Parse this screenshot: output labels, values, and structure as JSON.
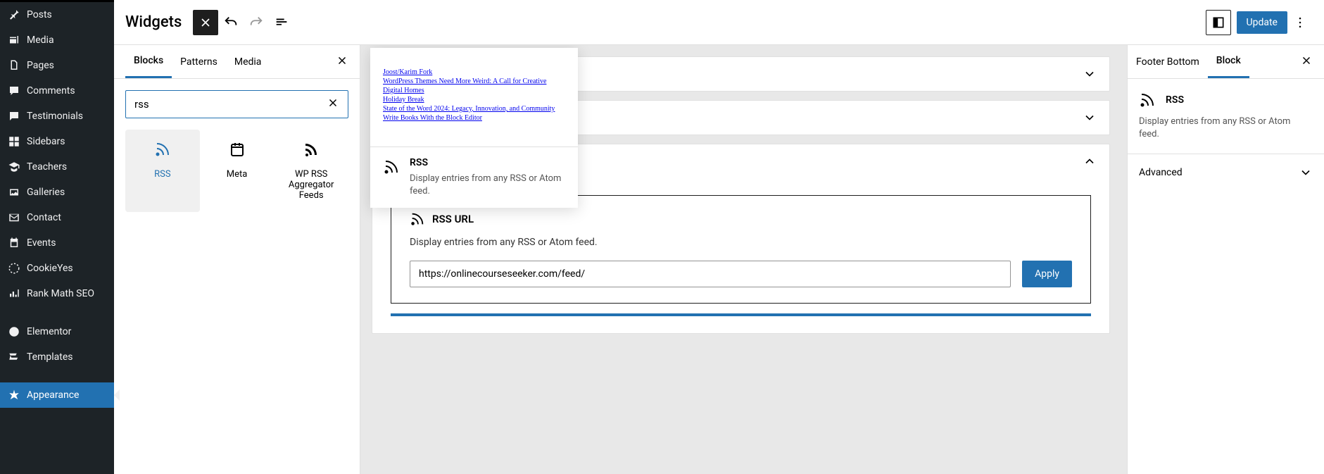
{
  "sidebar": {
    "items": [
      {
        "label": "Posts",
        "icon": "pin"
      },
      {
        "label": "Media",
        "icon": "media"
      },
      {
        "label": "Pages",
        "icon": "pages"
      },
      {
        "label": "Comments",
        "icon": "comments"
      },
      {
        "label": "Testimonials",
        "icon": "testimonials"
      },
      {
        "label": "Sidebars",
        "icon": "sidebars"
      },
      {
        "label": "Teachers",
        "icon": "teachers"
      },
      {
        "label": "Galleries",
        "icon": "galleries"
      },
      {
        "label": "Contact",
        "icon": "contact"
      },
      {
        "label": "Events",
        "icon": "events"
      },
      {
        "label": "CookieYes",
        "icon": "cookieyes"
      },
      {
        "label": "Rank Math SEO",
        "icon": "seo"
      },
      {
        "label": "Elementor",
        "icon": "elementor"
      },
      {
        "label": "Templates",
        "icon": "templates"
      },
      {
        "label": "Appearance",
        "icon": "appearance",
        "active": true
      }
    ]
  },
  "topbar": {
    "title": "Widgets",
    "update_label": "Update"
  },
  "inserter": {
    "tabs": [
      "Blocks",
      "Patterns",
      "Media"
    ],
    "search_value": "rss",
    "results": [
      {
        "label": "RSS",
        "lines": []
      },
      {
        "label": "Meta",
        "lines": []
      },
      {
        "label": "WP RSS Aggregator Feeds",
        "lines": []
      }
    ]
  },
  "preview": {
    "links": [
      "Joost/Karim Fork",
      "WordPress Themes Need More Weird: A Call for Creative Digital Homes",
      "Holiday Break",
      "State of the Word 2024: Legacy, Innovation, and Community",
      "Write Books With the Block Editor"
    ],
    "title": "RSS",
    "desc": "Display entries from any RSS or Atom feed."
  },
  "rss_block": {
    "header": "RSS URL",
    "desc": "Display entries from any RSS or Atom feed.",
    "url": "https://onlinecourseseeker.com/feed/",
    "apply_label": "Apply"
  },
  "settings": {
    "tabs": [
      "Footer Bottom",
      "Block"
    ],
    "block_title": "RSS",
    "block_desc": "Display entries from any RSS or Atom feed.",
    "advanced_label": "Advanced"
  }
}
